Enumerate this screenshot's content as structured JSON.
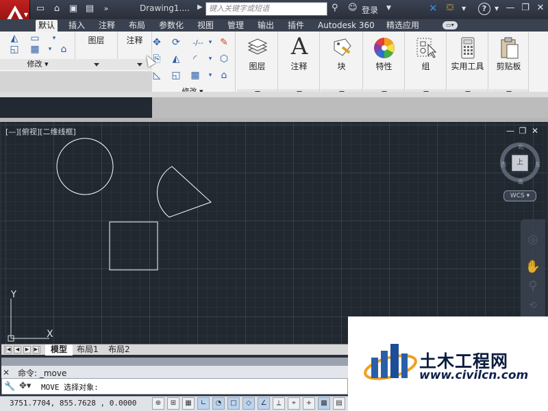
{
  "title": {
    "doc_title": "Drawing1....",
    "search_placeholder": "键入关键字或短语",
    "login": "登录"
  },
  "tabs": [
    "默认",
    "插入",
    "注释",
    "布局",
    "参数化",
    "视图",
    "管理",
    "输出",
    "插件",
    "Autodesk 360",
    "精选应用"
  ],
  "ribbon": {
    "modify_label": "修改",
    "layers_label_small": "图层",
    "annotation_label_small": "注释",
    "modify_label_2": "修改",
    "panels": {
      "layers": "图层",
      "annotation": "注释",
      "block": "块",
      "properties": "特性",
      "group": "组",
      "utilities": "实用工具",
      "clipboard": "剪贴板"
    }
  },
  "viewport": {
    "label": "[—][俯视][二维线框]",
    "compass": {
      "n": "北",
      "s": "南",
      "e": "东",
      "w": "西",
      "face": "上"
    },
    "wcs": "WCS",
    "ucs_x": "X",
    "ucs_y": "Y"
  },
  "layout_tabs": [
    "模型",
    "布局1",
    "布局2"
  ],
  "command": {
    "history": "命令:  _move",
    "prompt": "MOVE 选择对象:"
  },
  "status": {
    "coords": "3751.7704, 855.7628 , 0.0000"
  },
  "watermark": {
    "name": "土木工程网",
    "url": "www.civilcn.com"
  },
  "colors": {
    "viewport_bg": "#212830",
    "entity": "#ffffff",
    "brand": "#c02020"
  }
}
